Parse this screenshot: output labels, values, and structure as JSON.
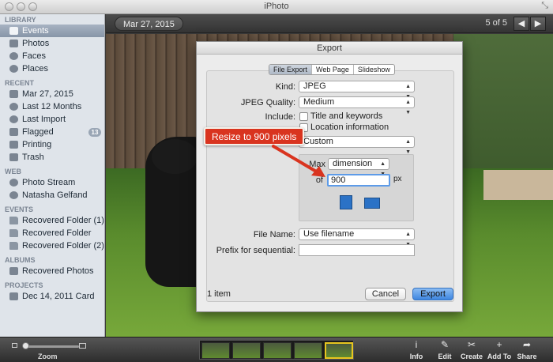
{
  "window": {
    "title": "iPhoto"
  },
  "sidebar": {
    "sections": [
      {
        "head": "LIBRARY",
        "items": [
          {
            "label": "Events",
            "icon": "events-icon",
            "selected": true
          },
          {
            "label": "Photos",
            "icon": "photos-icon"
          },
          {
            "label": "Faces",
            "icon": "faces-icon"
          },
          {
            "label": "Places",
            "icon": "places-icon"
          }
        ]
      },
      {
        "head": "RECENT",
        "items": [
          {
            "label": "Mar 27, 2015",
            "icon": "event-icon"
          },
          {
            "label": "Last 12 Months",
            "icon": "calendar-icon"
          },
          {
            "label": "Last Import",
            "icon": "clock-icon"
          },
          {
            "label": "Flagged",
            "icon": "flag-icon",
            "badge": "13"
          },
          {
            "label": "Printing",
            "icon": "printer-icon"
          },
          {
            "label": "Trash",
            "icon": "trash-icon"
          }
        ]
      },
      {
        "head": "WEB",
        "items": [
          {
            "label": "Photo Stream",
            "icon": "photo-stream-icon"
          },
          {
            "label": "Natasha Gelfand",
            "icon": "shared-stream-icon"
          }
        ]
      },
      {
        "head": "EVENTS",
        "items": [
          {
            "label": "Recovered Folder (1)",
            "icon": "folder-icon"
          },
          {
            "label": "Recovered Folder",
            "icon": "folder-icon"
          },
          {
            "label": "Recovered Folder (2)",
            "icon": "folder-icon"
          }
        ]
      },
      {
        "head": "ALBUMS",
        "items": [
          {
            "label": "Recovered Photos",
            "icon": "album-icon"
          }
        ]
      },
      {
        "head": "PROJECTS",
        "items": [
          {
            "label": "Dec 14, 2011 Card",
            "icon": "card-icon"
          }
        ]
      }
    ]
  },
  "topbar": {
    "event_title": "Mar 27, 2015",
    "counter": "5 of 5",
    "prev": "◀",
    "next": "▶"
  },
  "dialog": {
    "title": "Export",
    "tabs": [
      "File Export",
      "Web Page",
      "Slideshow"
    ],
    "active_tab": 0,
    "kind_label": "Kind:",
    "kind_value": "JPEG",
    "quality_label": "JPEG Quality:",
    "quality_value": "Medium",
    "include_label": "Include:",
    "include_title": "Title and keywords",
    "include_location": "Location information",
    "size_value": "Custom",
    "max_label": "Max",
    "max_value": "dimension",
    "of_label": "of",
    "size_field": "900",
    "px_label": "px",
    "filename_label": "File Name:",
    "filename_value": "Use filename",
    "prefix_label": "Prefix for sequential:",
    "prefix_value": "",
    "item_count": "1 item",
    "cancel": "Cancel",
    "export": "Export"
  },
  "callout": {
    "text": "Resize to 900 pixels"
  },
  "bottombar": {
    "zoom_label": "Zoom",
    "zoom_level": 0.0,
    "thumb_count": 5,
    "selected_thumb": 4,
    "tools": [
      {
        "label": "Info",
        "icon": "info-icon",
        "glyph": "i"
      },
      {
        "label": "Edit",
        "icon": "edit-icon",
        "glyph": "✎"
      },
      {
        "label": "Create",
        "icon": "create-icon",
        "glyph": "✂"
      },
      {
        "label": "Add To",
        "icon": "add-to-icon",
        "glyph": "+"
      },
      {
        "label": "Share",
        "icon": "share-icon",
        "glyph": "➦"
      }
    ]
  },
  "colors": {
    "accent": "#3e86e0",
    "callout": "#d9341f",
    "selection": "#8795a8"
  }
}
